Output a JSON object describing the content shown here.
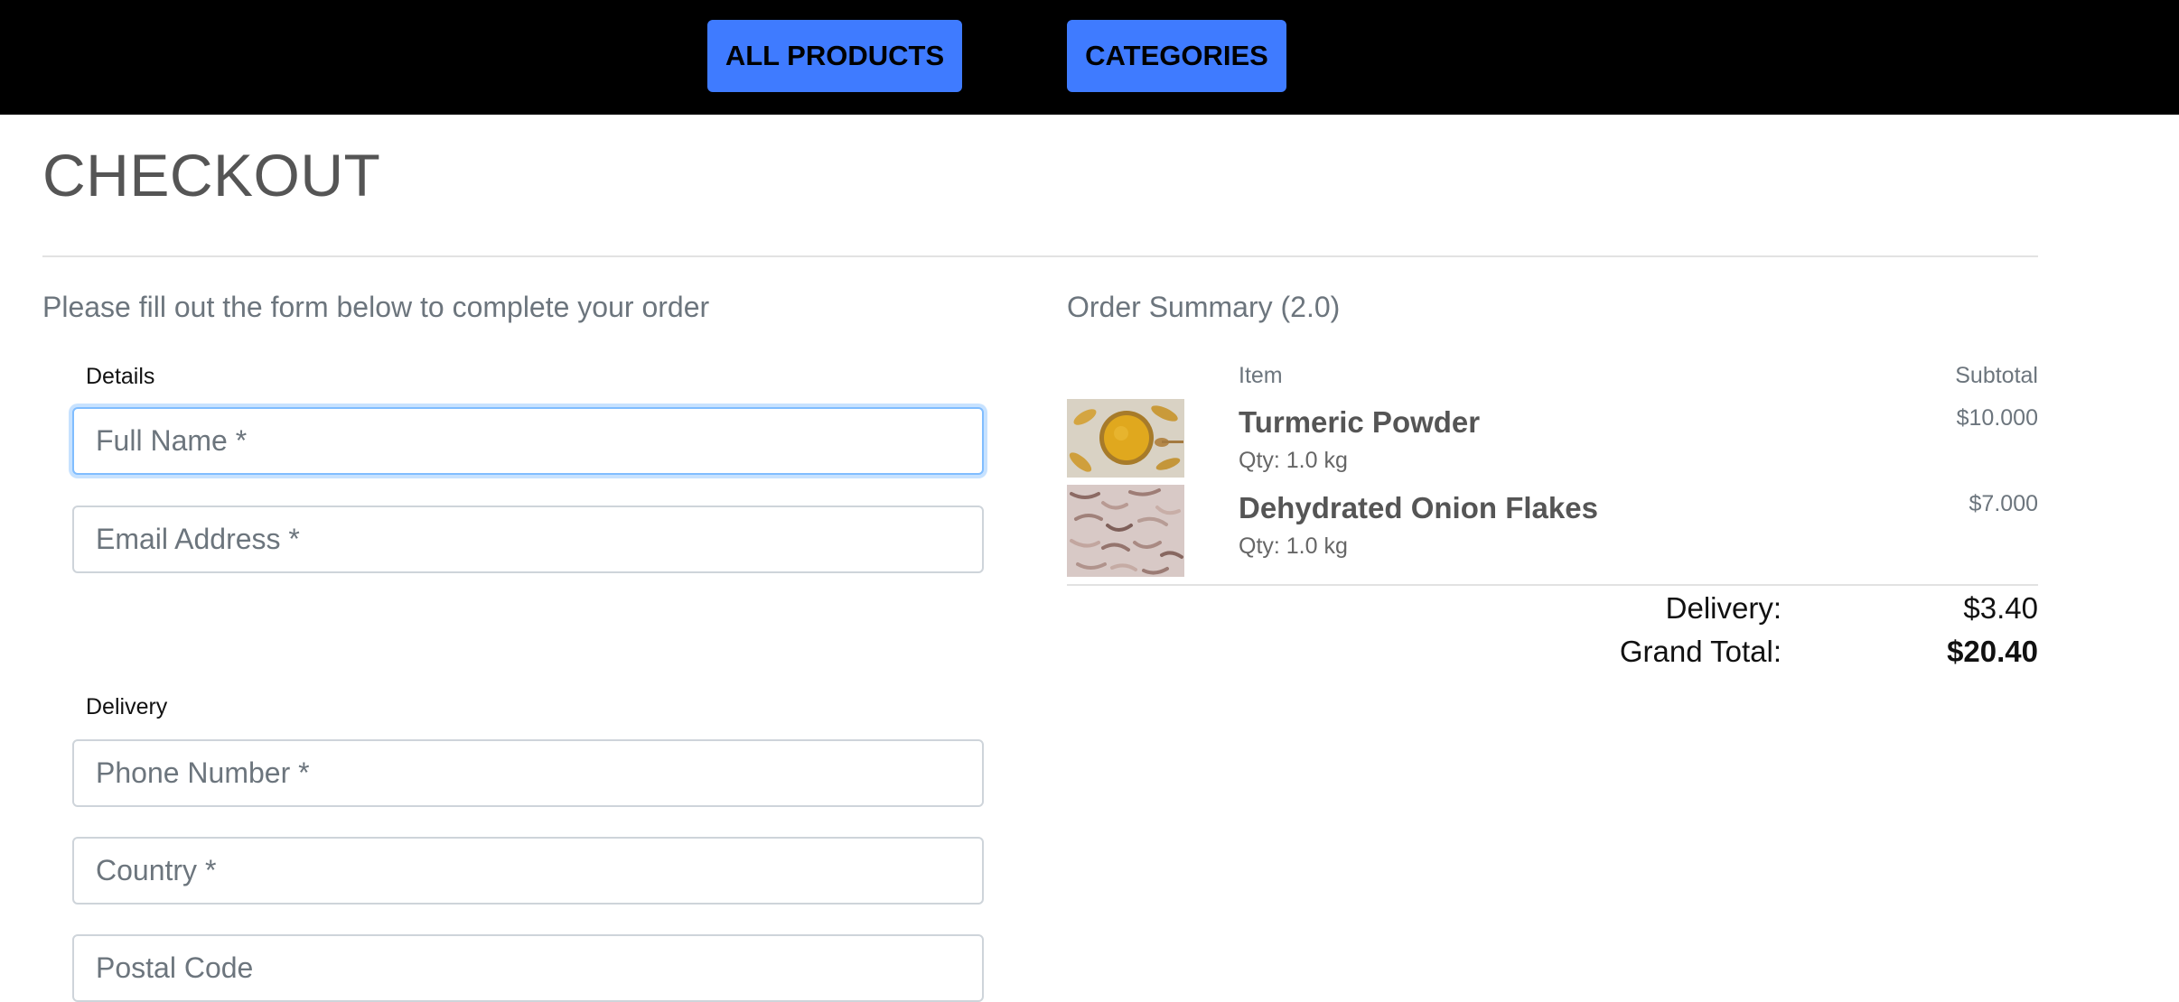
{
  "nav": {
    "all_products": "ALL PRODUCTS",
    "categories": "CATEGORIES",
    "accent_color": "#3f7bff"
  },
  "page": {
    "title": "CHECKOUT",
    "subtitle": "Please fill out the form below to complete your order"
  },
  "form": {
    "details_label": "Details",
    "full_name": {
      "value": "",
      "placeholder": "Full Name *"
    },
    "email": {
      "value": "",
      "placeholder": "Email Address *"
    },
    "delivery_label": "Delivery",
    "phone": {
      "value": "",
      "placeholder": "Phone Number *"
    },
    "country": {
      "value": "",
      "placeholder": "Country *"
    },
    "postal_code": {
      "value": "",
      "placeholder": "Postal Code"
    }
  },
  "summary": {
    "title": "Order Summary (2.0)",
    "col_item": "Item",
    "col_subtotal": "Subtotal",
    "items": [
      {
        "name": "Turmeric Powder",
        "qty": "Qty: 1.0 kg",
        "price": "$10.000",
        "image": "turmeric-powder-image"
      },
      {
        "name": "Dehydrated Onion Flakes",
        "qty": "Qty: 1.0 kg",
        "price": "$7.000",
        "image": "onion-flakes-image"
      }
    ],
    "delivery_label": "Delivery:",
    "delivery_value": "$3.40",
    "grand_total_label": "Grand Total:",
    "grand_total_value": "$20.40"
  }
}
